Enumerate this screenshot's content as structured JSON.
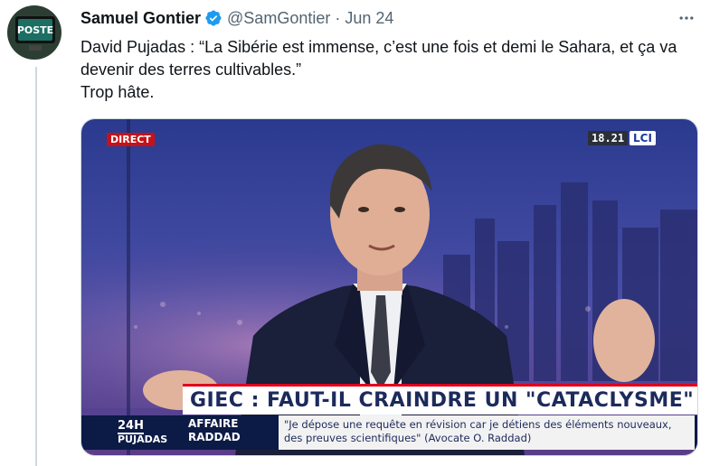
{
  "author": {
    "name": "Samuel Gontier",
    "handle": "@SamGontier",
    "separator": "·",
    "date": "Jun 24",
    "avatar_text": "POSTE"
  },
  "tweet": {
    "line1": "David Pujadas : “La Sibérie est immense, c’est une fois et demi le Sahara, et ça va devenir des terres cultivables.”",
    "line2": "Trop hâte."
  },
  "media": {
    "live_tag": "DIRECT",
    "clock": "18.21",
    "channel_logo": "LCI",
    "headline": "GIEC : FAUT-IL CRAINDRE UN \"CATACLYSME\" ?",
    "show_line1": "24H",
    "show_line2": "PUJADAS",
    "topic": "AFFAIRE RADDAD",
    "quote": "\"Je dépose une requête en révision car je détiens des éléments nouveaux, des preuves scientifiques\" (Avocate O. Raddad)"
  },
  "colors": {
    "verified": "#1d9bf0",
    "muted_text": "#536471",
    "live_red": "#c4121a",
    "banner_navy": "#0c1a46"
  },
  "icons": {
    "verified": "verified-badge-icon",
    "more": "more-options-icon"
  }
}
